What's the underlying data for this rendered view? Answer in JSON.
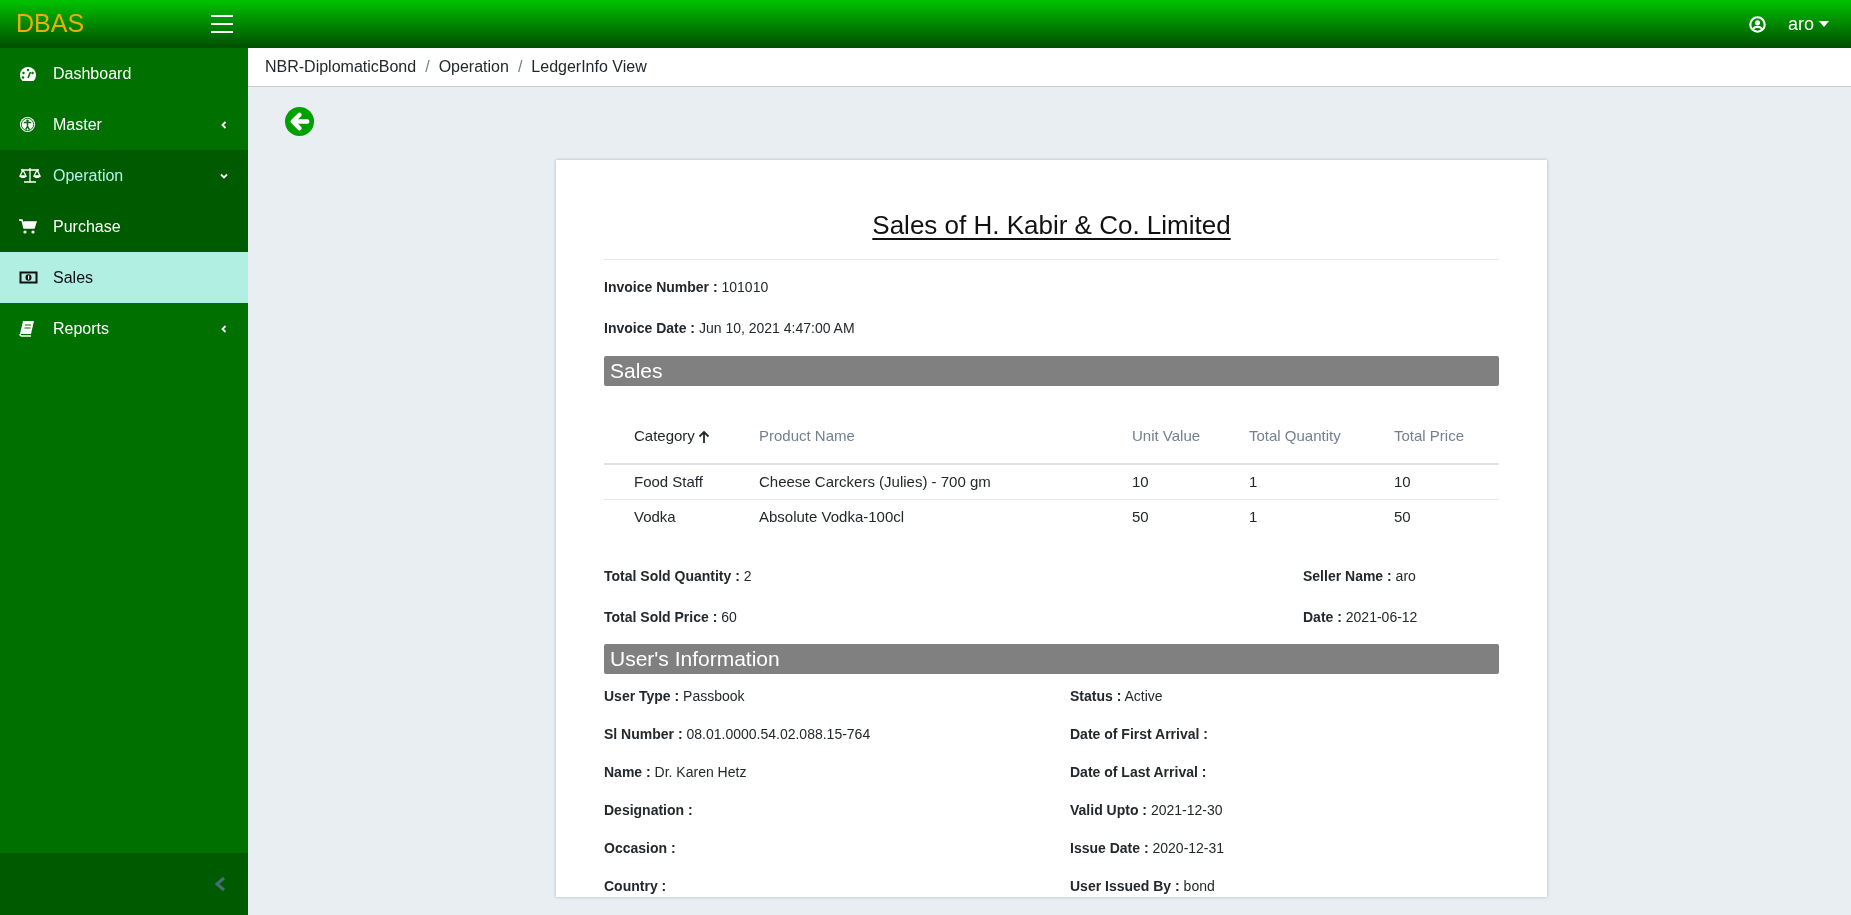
{
  "topbar": {
    "logo": "DBAS",
    "user": "aro"
  },
  "sidebar": {
    "items": [
      {
        "label": "Dashboard",
        "selected": false
      },
      {
        "label": "Master",
        "selected": false,
        "expanded": false
      },
      {
        "label": "Operation",
        "selected": false,
        "expanded": true,
        "children": [
          {
            "label": "Purchase",
            "selected": false
          },
          {
            "label": "Sales",
            "selected": true
          }
        ]
      },
      {
        "label": "Reports",
        "selected": false,
        "expanded": false
      }
    ]
  },
  "breadcrumb": {
    "separator": "/",
    "items": [
      "NBR-DiplomaticBond",
      "Operation",
      "LedgerInfo View"
    ]
  },
  "card": {
    "title": "Sales of H. Kabir & Co. Limited",
    "invoice_fields": [
      {
        "label": "Invoice Number :",
        "value": "101010"
      },
      {
        "label": "Invoice Date :",
        "value": "Jun 10, 2021 4:47:00 AM"
      }
    ],
    "sales_heading": "Sales",
    "table": {
      "columns": [
        {
          "label": "Category",
          "sorted": true
        },
        {
          "label": "Product Name",
          "sorted": false
        },
        {
          "label": "Unit Value",
          "sorted": false
        },
        {
          "label": "Total Quantity",
          "sorted": false
        },
        {
          "label": "Total Price",
          "sorted": false
        }
      ],
      "rows": [
        [
          "Food Staff",
          "Cheese Carckers (Julies) - 700 gm",
          "10",
          "1",
          "10"
        ],
        [
          "Vodka",
          "Absolute Vodka-100cl",
          "50",
          "1",
          "50"
        ]
      ]
    },
    "totals_left": [
      {
        "label": "Total Sold Quantity :",
        "value": "2"
      },
      {
        "label": "Total Sold Price :",
        "value": "60"
      }
    ],
    "totals_right": [
      {
        "label": "Seller Name :",
        "value": "aro"
      },
      {
        "label": "Date :",
        "value": "2021-06-12"
      }
    ],
    "user_heading": "User's Information",
    "user_fields": [
      {
        "label": "User Type :",
        "value": "Passbook"
      },
      {
        "label": "Status :",
        "value": "Active"
      },
      {
        "label": "Sl Number :",
        "value": "08.01.0000.54.02.088.15-764"
      },
      {
        "label": "Date of First Arrival :"
      },
      {
        "label": "Name :",
        "value": "Dr. Karen Hetz"
      },
      {
        "label": "Date of Last Arrival :"
      },
      {
        "label": "Designation :"
      },
      {
        "label": "Valid Upto :",
        "value": "2021-12-30"
      },
      {
        "label": "Occasion :"
      },
      {
        "label": "Issue Date :",
        "value": "2020-12-31"
      },
      {
        "label": "Country :"
      },
      {
        "label": "User Issued By :",
        "value": "bond"
      }
    ]
  }
}
